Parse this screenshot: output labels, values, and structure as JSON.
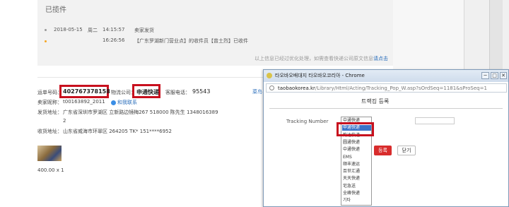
{
  "tracking": {
    "status_title": "已揽件",
    "events": [
      {
        "date": "2018-05-15",
        "weekday": "周二",
        "time": "14:15:57",
        "desc": "卖家发货"
      },
      {
        "date": "",
        "weekday": "",
        "time": "16:26:56",
        "desc": "【广东罗湖新门营业点】的收件员【曾土烈】已收件"
      }
    ],
    "note": "以上信息已经过优化处理，如需查看快递公司原文信息",
    "note_link": "请点击"
  },
  "order": {
    "tracking_no_label": "运单号码：",
    "tracking_no": "402767378158",
    "carrier_label": "物流公司：",
    "carrier": "申通快递",
    "hotline_label": "客服电话：",
    "hotline": "95543",
    "seller_label": "卖家昵称：",
    "seller": "t00163892_2011",
    "contact": "和我联系",
    "ship_from_label": "发货地址：",
    "ship_from": "广东省深圳市罗湖区 立新路边镜梅267 518000   陈先生      1348016389",
    "ship_from_cont": "2",
    "ship_to_label": "收货地址：",
    "ship_to": "山东省威海市环翠区 264205   TK*     151****6952",
    "price": "400.00 x 1",
    "side_link": "菜鸟"
  },
  "popup": {
    "window_title": "타오바오배대지 타오바오코리아 - Chrome",
    "url_host": "taobaokorea.kr",
    "url_path": "/Library/Html/Acting/Tracking_Pop_W.asp?sOrdSeq=1181&sProSeq=1",
    "dialog_title": "트랙킹 등록",
    "field_label": "Tracking Number",
    "carriers": [
      "中通快递",
      "申通快递",
      "韵达快递",
      "圆通快递",
      "中通快递",
      "EMS",
      "顺丰速运",
      "百世汇通",
      "天天快递",
      "宅急送",
      "全峰快递",
      "기타"
    ],
    "selected_index": 1,
    "submit_label": "등록",
    "close_label": "닫기",
    "win_min": "─",
    "win_max": "□",
    "win_close": "✕"
  }
}
